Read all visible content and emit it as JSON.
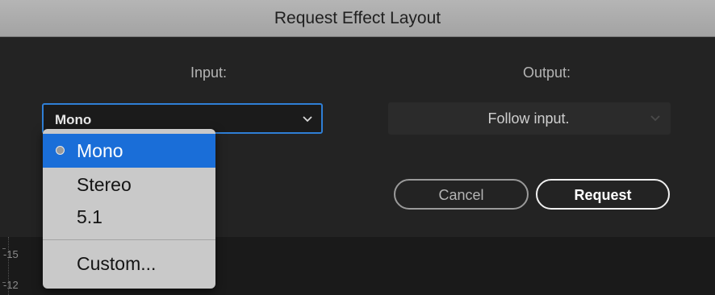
{
  "dialog": {
    "title": "Request Effect Layout"
  },
  "input": {
    "label": "Input:",
    "selected": "Mono",
    "options": [
      "Mono",
      "Stereo",
      "5.1",
      "Custom..."
    ]
  },
  "output": {
    "label": "Output:",
    "selected": "Follow input."
  },
  "buttons": {
    "cancel": "Cancel",
    "request": "Request"
  },
  "background": {
    "ruler_marks": [
      "-15",
      "-12"
    ]
  },
  "colors": {
    "accent": "#1a6ed8",
    "focus_border": "#2f7fd6",
    "menu_bg": "#c9c9c9",
    "dialog_bg": "#232323"
  }
}
